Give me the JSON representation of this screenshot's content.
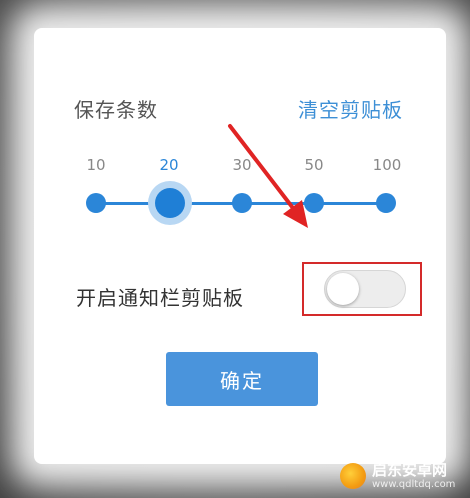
{
  "dialog": {
    "title": "保存条数",
    "clear_link": "清空剪贴板",
    "slider": {
      "ticks": [
        "10",
        "20",
        "30",
        "50",
        "100"
      ],
      "selected": "20"
    },
    "notification_label": "开启通知栏剪贴板",
    "notification_toggle_on": false,
    "confirm_label": "确定"
  },
  "watermark": {
    "main": "启东安卓网",
    "sub": "www.qdltdq.com"
  },
  "colors": {
    "accent": "#2b86d8",
    "annotation": "#d42a2a",
    "button": "#4a94dc"
  }
}
